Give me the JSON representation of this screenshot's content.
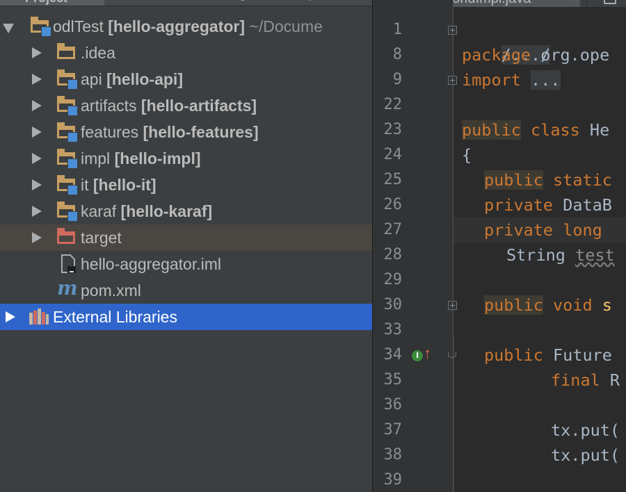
{
  "project_panel": {
    "tab_label": "Project",
    "tree": [
      {
        "id": "root",
        "label": "odlTest",
        "module": "[hello-aggregator]",
        "hint": "~/Docume",
        "icon": "folder-icon",
        "expanded": true
      },
      {
        "id": "idea",
        "label": ".idea",
        "icon": "folder-icon"
      },
      {
        "id": "api",
        "label": "api",
        "module": "[hello-api]",
        "icon": "module-folder-icon"
      },
      {
        "id": "artifacts",
        "label": "artifacts",
        "module": "[hello-artifacts]",
        "icon": "module-folder-icon"
      },
      {
        "id": "features",
        "label": "features",
        "module": "[hello-features]",
        "icon": "module-folder-icon"
      },
      {
        "id": "impl",
        "label": "impl",
        "module": "[hello-impl]",
        "icon": "module-folder-icon"
      },
      {
        "id": "it",
        "label": "it",
        "module": "[hello-it]",
        "icon": "module-folder-icon"
      },
      {
        "id": "karaf",
        "label": "karaf",
        "module": "[hello-karaf]",
        "icon": "module-folder-icon"
      },
      {
        "id": "target",
        "label": "target",
        "icon": "excluded-folder-icon"
      },
      {
        "id": "iml",
        "label": "hello-aggregator.iml",
        "icon": "iml-file-icon"
      },
      {
        "id": "pom",
        "label": "pom.xml",
        "icon": "maven-icon"
      },
      {
        "id": "external",
        "label": "External Libraries",
        "icon": "libraries-icon",
        "selected": true
      }
    ]
  },
  "editor": {
    "tab_label": "HelloWorldImpl.java",
    "line_numbers": [
      "1",
      "8",
      "9",
      "22",
      "23",
      "24",
      "25",
      "26",
      "27",
      "28",
      "29",
      "30",
      "33",
      "34",
      "35",
      "36",
      "37",
      "38",
      "39"
    ],
    "lines": {
      "l1": "/.../",
      "l8_kw": "package",
      "l8_rest": " org.ope",
      "l9_kw": "import",
      "l9_fold": "...",
      "l23_kw1": "public",
      "l23_kw2": " class",
      "l23_rest": " He",
      "l24": "{",
      "l25_kw1": "public",
      "l25_kw2": " static",
      "l26_kw": "private",
      "l26_rest": " DataB",
      "l27_kw1": "private",
      "l27_kw2": " long",
      "l28_type": "String",
      "l28_var": "test",
      "l30_kw1": "public",
      "l30_kw2": " void",
      "l30_rest": " s",
      "l34_kw": "public",
      "l34_rest": " Future",
      "l35_kw": "final",
      "l35_rest": " R",
      "l37": "tx.put(",
      "l38": "tx.put("
    },
    "gutter_marker": "I"
  },
  "colors": {
    "panel_bg": "#3c3f41",
    "editor_bg": "#2b2b2b",
    "selection": "#2f65ca",
    "keyword": "#cc7832",
    "text": "#a9b7c6",
    "folder": "#c79f62",
    "excluded_folder": "#d06a5f",
    "module_badge": "#4a8ed8"
  }
}
